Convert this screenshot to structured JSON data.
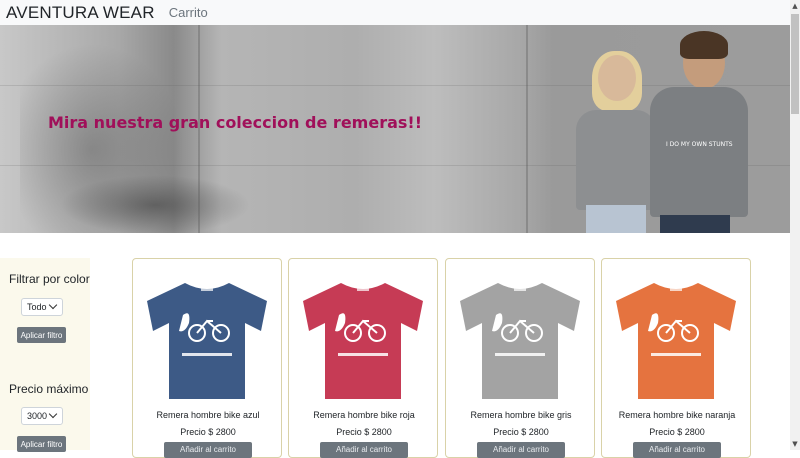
{
  "navbar": {
    "brand": "AVENTURA WEAR",
    "cart_link": "Carrito"
  },
  "hero": {
    "headline": "Mira nuestra gran coleccion de remeras!!",
    "print_text": "I DO MY OWN STUNTS"
  },
  "sidebar": {
    "color_filter": {
      "title": "Filtrar por color",
      "selected": "Todo",
      "button": "Aplicar filtro"
    },
    "price_filter": {
      "title": "Precio máximo",
      "selected": "3000",
      "button": "Aplicar filtro"
    }
  },
  "products": [
    {
      "name": "Remera hombre bike azul",
      "price": "Precio $ 2800",
      "color": "#3d5a86",
      "button": "Añadir al carrito"
    },
    {
      "name": "Remera hombre bike roja",
      "price": "Precio $ 2800",
      "color": "#c63b55",
      "button": "Añadir al carrito"
    },
    {
      "name": "Remera hombre bike gris",
      "price": "Precio $ 2800",
      "color": "#a3a3a3",
      "button": "Añadir al carrito"
    },
    {
      "name": "Remera hombre bike naranja",
      "price": "Precio $ 2800",
      "color": "#e5733f",
      "button": "Añadir al carrito"
    }
  ],
  "colors": {
    "accent_text": "#a0105a",
    "button": "#6c757d",
    "sidebar_bg": "#fbf9ec",
    "navbar_bg": "#f8f9fa"
  }
}
